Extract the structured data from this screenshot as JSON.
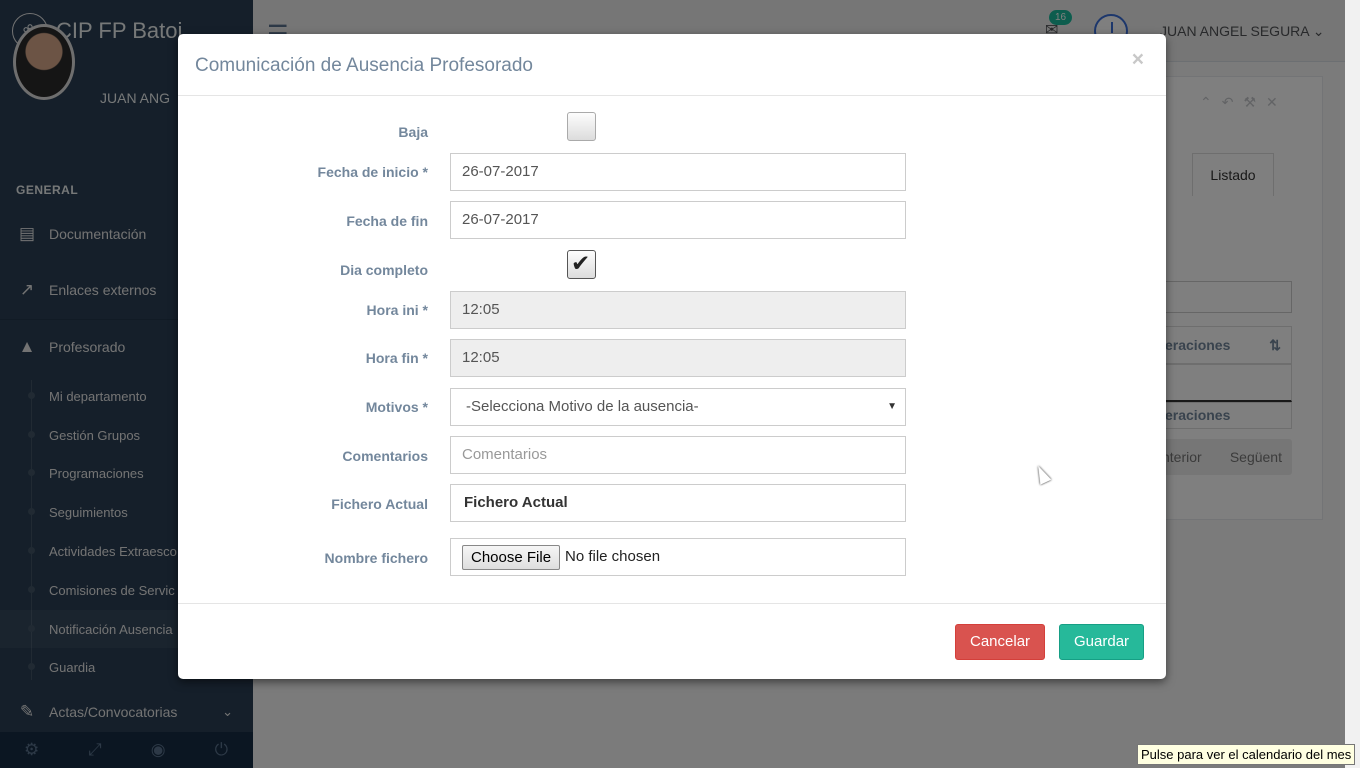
{
  "sidebar": {
    "brand": "CIP FP Batoi",
    "profile_name": "JUAN ANG",
    "section": "GENERAL",
    "items": [
      {
        "label": "Documentación",
        "icon": "book-icon"
      },
      {
        "label": "Enlaces externos",
        "icon": "external-link-icon"
      },
      {
        "label": "Profesorado",
        "icon": "graduation-cap-icon"
      }
    ],
    "subitems": [
      {
        "label": "Mi departamento"
      },
      {
        "label": "Gestión Grupos"
      },
      {
        "label": "Programaciones"
      },
      {
        "label": "Seguimientos"
      },
      {
        "label": "Actividades Extraesco"
      },
      {
        "label": "Comisiones de Servic"
      },
      {
        "label": "Notificación Ausencia"
      },
      {
        "label": "Guardia"
      }
    ],
    "actas": {
      "label": "Actas/Convocatorias",
      "icon": "edit-icon"
    },
    "footer_icons": [
      "settings-icon",
      "fullscreen-icon",
      "eye-slash-icon",
      "power-icon"
    ]
  },
  "topnav": {
    "mail_count": "16",
    "user": "JUAN ANGEL SEGURA"
  },
  "background": {
    "tab": "Listado",
    "col_header": "eraciones",
    "col_footer": "eraciones",
    "pager_prev": "nterior",
    "pager_next": "Següent"
  },
  "modal": {
    "title": "Comunicación de Ausencia Profesorado",
    "close": "×",
    "fields": {
      "baja": {
        "label": "Baja",
        "checked": false
      },
      "fecha_inicio": {
        "label": "Fecha de inicio *",
        "value": "26-07-2017"
      },
      "fecha_fin": {
        "label": "Fecha de fin",
        "value": "26-07-2017"
      },
      "dia_completo": {
        "label": "Dia completo",
        "checked": true
      },
      "hora_ini": {
        "label": "Hora ini *",
        "value": "12:05"
      },
      "hora_fin": {
        "label": "Hora fin *",
        "value": "12:05"
      },
      "motivos": {
        "label": "Motivos *",
        "value": "-Selecciona Motivo de la ausencia-"
      },
      "comentarios": {
        "label": "Comentarios",
        "placeholder": "Comentarios"
      },
      "fichero_actual": {
        "label": "Fichero Actual",
        "value": "Fichero Actual"
      },
      "nombre_fichero": {
        "label": "Nombre fichero",
        "button": "Choose File",
        "status": "No file chosen"
      }
    },
    "cancel": "Cancelar",
    "save": "Guardar"
  },
  "tooltip": "Pulse para ver el calendario del mes",
  "colors": {
    "sidebar": "#2a3f54",
    "accent": "#26b99a",
    "danger": "#d9534f",
    "label": "#73879c"
  }
}
